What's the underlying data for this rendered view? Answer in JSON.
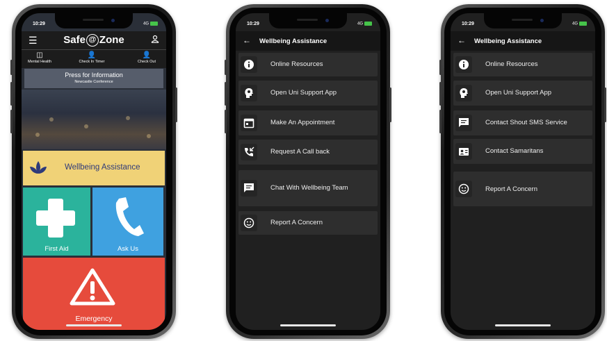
{
  "phone1": {
    "status": {
      "time": "10:29",
      "signal": "4G"
    },
    "brand": {
      "part1": "Safe",
      "at": "@",
      "part2": "Zone"
    },
    "quick": [
      {
        "label": "Mental Health",
        "icon": "mental-health-icon"
      },
      {
        "label": "Check In Timer",
        "icon": "check-in-timer-icon"
      },
      {
        "label": "Check Out",
        "icon": "check-out-icon"
      }
    ],
    "info": {
      "title": "Press for Information",
      "subtitle": "Newcastle Conference"
    },
    "tiles": {
      "wellbeing": "Wellbeing Assistance",
      "first_aid": "First Aid",
      "ask_us": "Ask Us",
      "emergency": "Emergency"
    },
    "colors": {
      "wellbeing": "#f0d277",
      "first_aid": "#2bb39c",
      "ask_us": "#3fa1e0",
      "emergency": "#e64b3c"
    }
  },
  "phone2": {
    "status": {
      "time": "10:29",
      "signal": "4G"
    },
    "title": "Wellbeing Assistance",
    "items": [
      {
        "label": "Online Resources",
        "icon": "info-icon"
      },
      {
        "label": "Open Uni Support App",
        "icon": "head-support-icon"
      },
      {
        "label": "Make An Appointment",
        "icon": "calendar-icon"
      },
      {
        "label": "Request A Call back",
        "icon": "phone-callback-icon"
      },
      {
        "label": "Chat With Wellbeing Team",
        "icon": "chat-icon"
      },
      {
        "label": "Report A Concern",
        "icon": "smiley-icon"
      }
    ]
  },
  "phone3": {
    "status": {
      "time": "10:29",
      "signal": "4G"
    },
    "title": "Wellbeing Assistance",
    "items": [
      {
        "label": "Online Resources",
        "icon": "info-icon"
      },
      {
        "label": "Open Uni Support App",
        "icon": "head-support-icon"
      },
      {
        "label": "Contact Shout SMS Service",
        "icon": "chat-icon"
      },
      {
        "label": "Contact Samaritans",
        "icon": "contact-card-icon"
      },
      {
        "label": "Report A Concern",
        "icon": "smiley-icon"
      }
    ]
  }
}
